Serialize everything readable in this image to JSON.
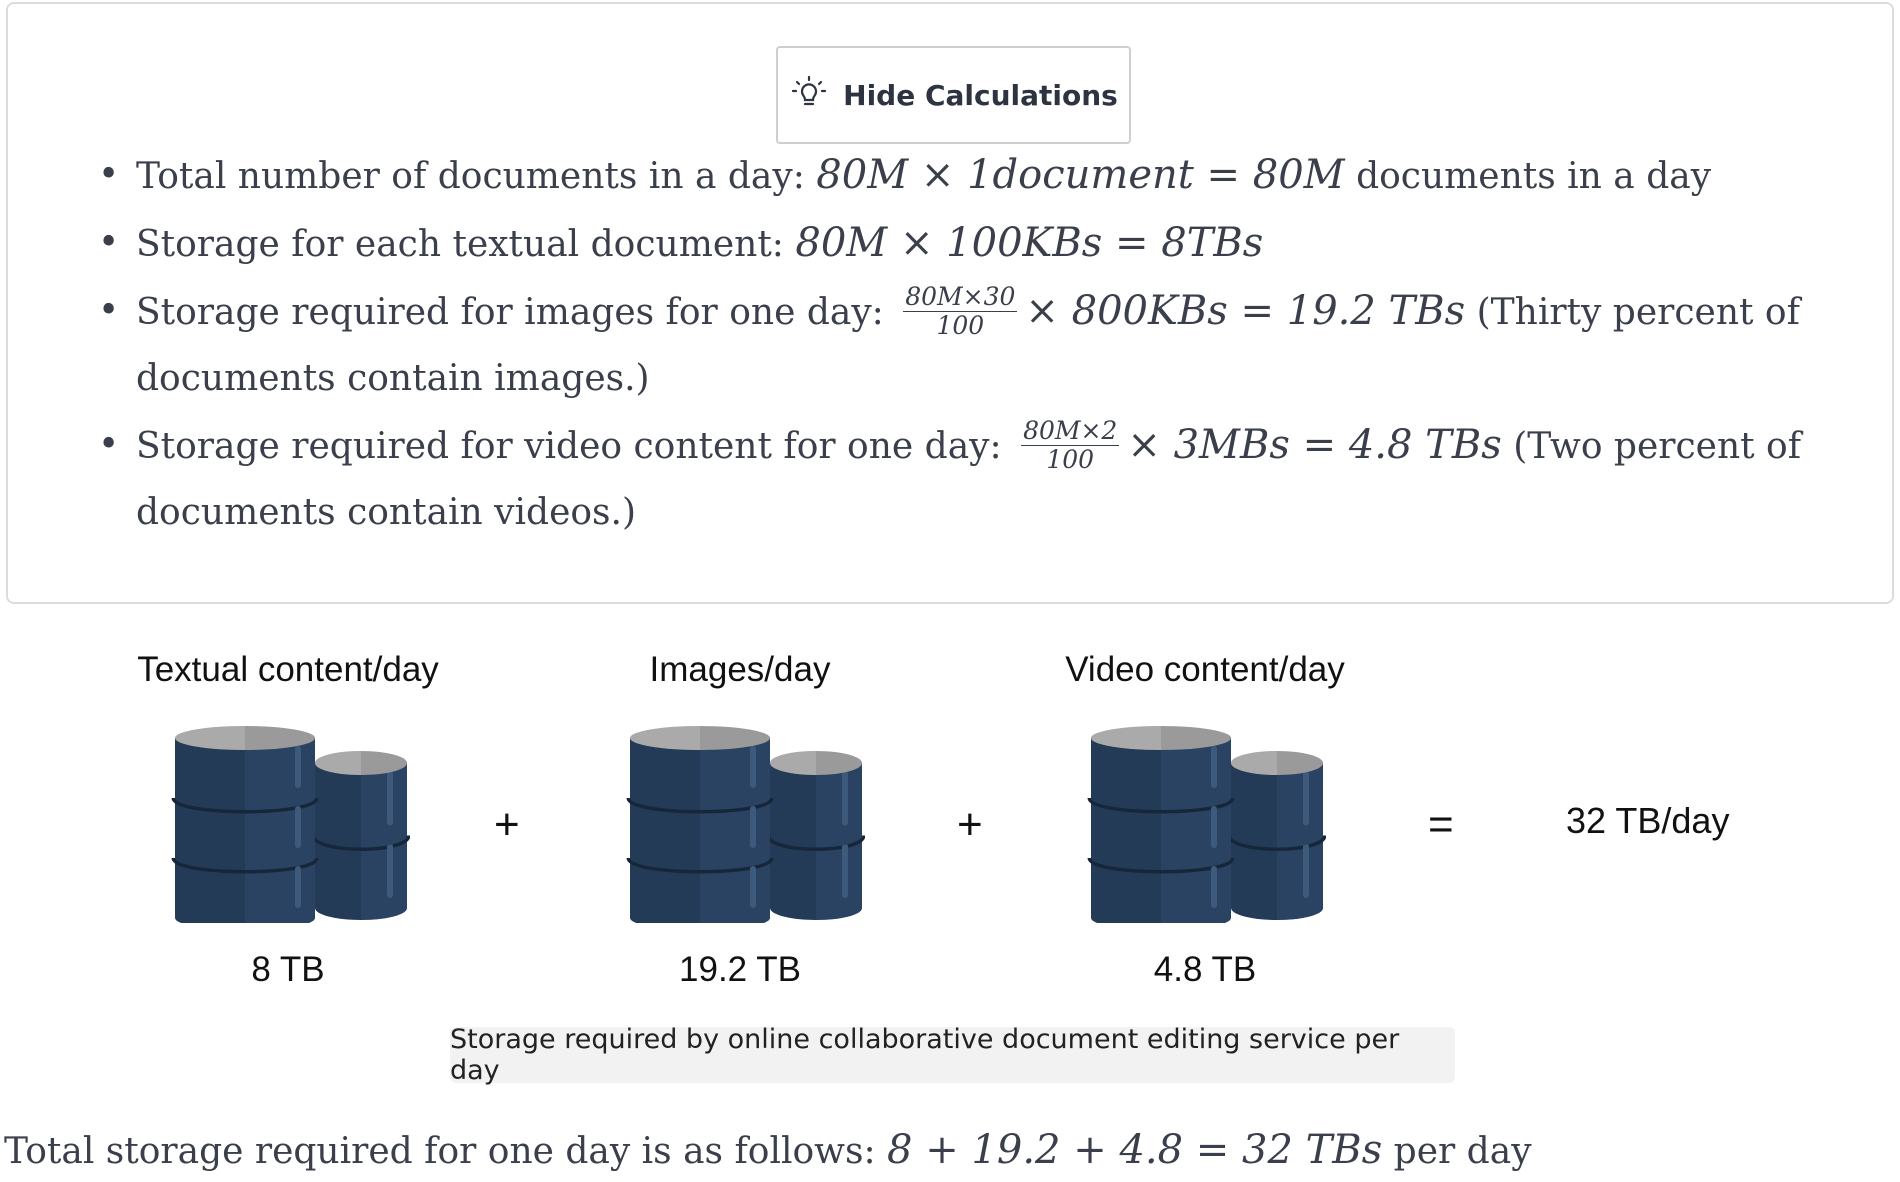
{
  "button": {
    "label": "Hide Calculations",
    "icon": "lightbulb-icon"
  },
  "calculations": [
    {
      "label": "Total number of documents in a day:",
      "expr": "80M × 1document = 80M",
      "suffix": " documents in a day"
    },
    {
      "label": "Storage for each textual document:",
      "expr": "80M × 100KBs = 8TBs",
      "suffix": ""
    },
    {
      "label": "Storage required for images for one day:",
      "frac_num": "80M×30",
      "frac_den": "100",
      "expr": "× 800KBs = 19.2 TBs",
      "suffix": " (Thirty percent of documents contain images.)"
    },
    {
      "label": "Storage required for video content for one day:",
      "frac_num": "80M×2",
      "frac_den": "100",
      "expr": "× 3MBs = 4.8 TBs",
      "suffix": " (Two percent of documents contain videos.)"
    }
  ],
  "figure": {
    "columns": [
      {
        "title": "Textual content/day",
        "value": "8 TB"
      },
      {
        "title": "Images/day",
        "value": "19.2 TB"
      },
      {
        "title": "Video content/day",
        "value": "4.8 TB"
      }
    ],
    "operators": [
      "+",
      "+",
      "="
    ],
    "total": "32 TB/day",
    "caption": "Storage required by online collaborative document editing service per day",
    "colors": {
      "db_dark": "#243b57",
      "db_light": "#2e4a6b",
      "db_top": "#9a9a9a",
      "db_band": "#16273a"
    }
  },
  "summary": {
    "label": "Total storage required for one day is as follows:",
    "expr": "8 + 19.2 + 4.8 = 32 TBs",
    "suffix": " per day"
  }
}
